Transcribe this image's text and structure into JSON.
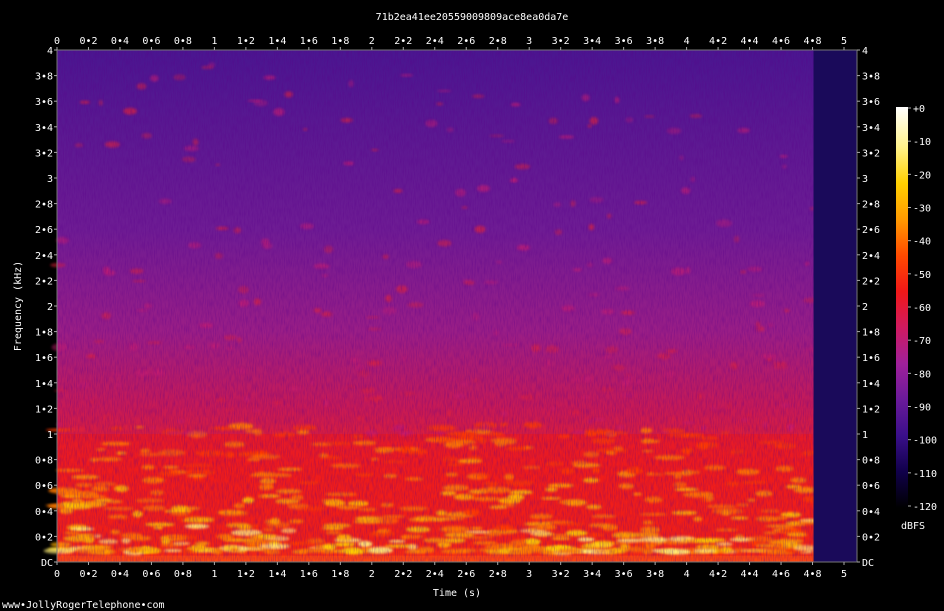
{
  "chart_data": {
    "type": "heatmap",
    "title": "71b2ea41ee20559009809ace8ea0da7e",
    "xlabel": "Time (s)",
    "ylabel": "Frequency (kHz)",
    "xlim": [
      0,
      5
    ],
    "ylim": [
      0,
      4
    ],
    "x_ticks": [
      {
        "value": 0,
        "label": "0"
      },
      {
        "value": 0.2,
        "label": "0•2"
      },
      {
        "value": 0.4,
        "label": "0•4"
      },
      {
        "value": 0.6,
        "label": "0•6"
      },
      {
        "value": 0.8,
        "label": "0•8"
      },
      {
        "value": 1.0,
        "label": "1"
      },
      {
        "value": 1.2,
        "label": "1•2"
      },
      {
        "value": 1.4,
        "label": "1•4"
      },
      {
        "value": 1.6,
        "label": "1•6"
      },
      {
        "value": 1.8,
        "label": "1•8"
      },
      {
        "value": 2.0,
        "label": "2"
      },
      {
        "value": 2.2,
        "label": "2•2"
      },
      {
        "value": 2.4,
        "label": "2•4"
      },
      {
        "value": 2.6,
        "label": "2•6"
      },
      {
        "value": 2.8,
        "label": "2•8"
      },
      {
        "value": 3.0,
        "label": "3"
      },
      {
        "value": 3.2,
        "label": "3•2"
      },
      {
        "value": 3.4,
        "label": "3•4"
      },
      {
        "value": 3.6,
        "label": "3•6"
      },
      {
        "value": 3.8,
        "label": "3•8"
      },
      {
        "value": 4.0,
        "label": "4"
      },
      {
        "value": 4.2,
        "label": "4•2"
      },
      {
        "value": 4.4,
        "label": "4•4"
      },
      {
        "value": 4.6,
        "label": "4•6"
      },
      {
        "value": 4.8,
        "label": "4•8"
      },
      {
        "value": 5.0,
        "label": "5"
      }
    ],
    "y_ticks": [
      {
        "value": 0,
        "label": "DC"
      },
      {
        "value": 0.2,
        "label": "0•2"
      },
      {
        "value": 0.4,
        "label": "0•4"
      },
      {
        "value": 0.6,
        "label": "0•6"
      },
      {
        "value": 0.8,
        "label": "0•8"
      },
      {
        "value": 1.0,
        "label": "1"
      },
      {
        "value": 1.2,
        "label": "1•2"
      },
      {
        "value": 1.4,
        "label": "1•4"
      },
      {
        "value": 1.6,
        "label": "1•6"
      },
      {
        "value": 1.8,
        "label": "1•8"
      },
      {
        "value": 2.0,
        "label": "2"
      },
      {
        "value": 2.2,
        "label": "2•2"
      },
      {
        "value": 2.4,
        "label": "2•4"
      },
      {
        "value": 2.6,
        "label": "2•6"
      },
      {
        "value": 2.8,
        "label": "2•8"
      },
      {
        "value": 3.0,
        "label": "3"
      },
      {
        "value": 3.2,
        "label": "3•2"
      },
      {
        "value": 3.4,
        "label": "3•4"
      },
      {
        "value": 3.6,
        "label": "3•6"
      },
      {
        "value": 3.8,
        "label": "3•8"
      },
      {
        "value": 4.0,
        "label": "4"
      }
    ],
    "colorbar": {
      "label": "dBFS",
      "range": [
        -120,
        0
      ],
      "ticks": [
        {
          "value": 0,
          "label": "+0"
        },
        {
          "value": -10,
          "label": "-10"
        },
        {
          "value": -20,
          "label": "-20"
        },
        {
          "value": -30,
          "label": "-30"
        },
        {
          "value": -40,
          "label": "-40"
        },
        {
          "value": -50,
          "label": "-50"
        },
        {
          "value": -60,
          "label": "-60"
        },
        {
          "value": -70,
          "label": "-70"
        },
        {
          "value": -80,
          "label": "-80"
        },
        {
          "value": -90,
          "label": "-90"
        },
        {
          "value": -100,
          "label": "-100"
        },
        {
          "value": -110,
          "label": "-110"
        },
        {
          "value": -120,
          "label": "-120"
        }
      ],
      "colors": [
        "#000000",
        "#10004a",
        "#3a0f8a",
        "#6a1a9a",
        "#a0209a",
        "#d01a60",
        "#f01818",
        "#ff4a00",
        "#ff9a00",
        "#ffd000",
        "#fff28a",
        "#ffffff"
      ]
    },
    "audio_end_s": 4.8,
    "approx_levels_dbfs": {
      "background_high_freq": -80,
      "speech_band_0_to_1khz": -45,
      "formant_peaks": -25,
      "after_audio_end": -110
    },
    "grid": false
  },
  "footer": {
    "credit": "www•JollyRogerTelephone•com"
  }
}
